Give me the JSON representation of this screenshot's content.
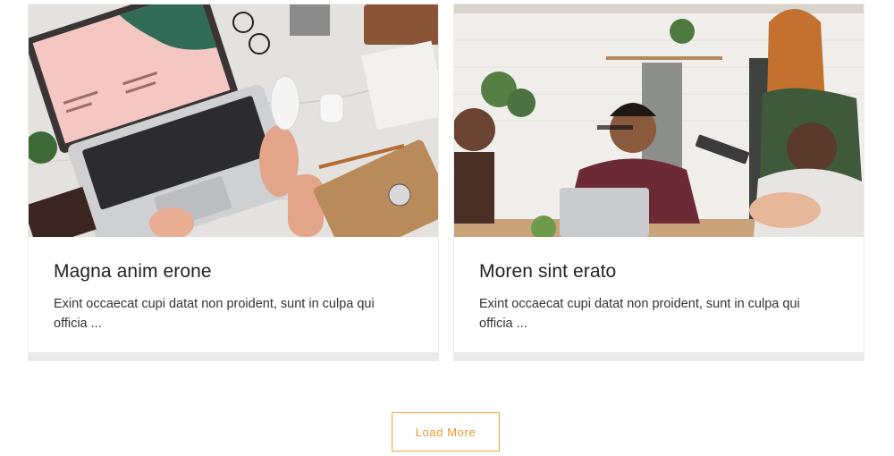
{
  "cards": [
    {
      "title": "Magna anim erone",
      "excerpt": "Exint occaecat cupi datat non proident, sunt in culpa qui officia ...",
      "image_label": "laptop-desk-photo"
    },
    {
      "title": "Moren sint erato",
      "excerpt": "Exint occaecat cupi datat non proident, sunt in culpa qui officia ...",
      "image_label": "team-meeting-photo"
    }
  ],
  "load_more": {
    "label": "Load More"
  },
  "colors": {
    "accent": "#f0a63a",
    "title": "#222222",
    "text": "#333333",
    "card_footer": "#e9e9e9"
  }
}
